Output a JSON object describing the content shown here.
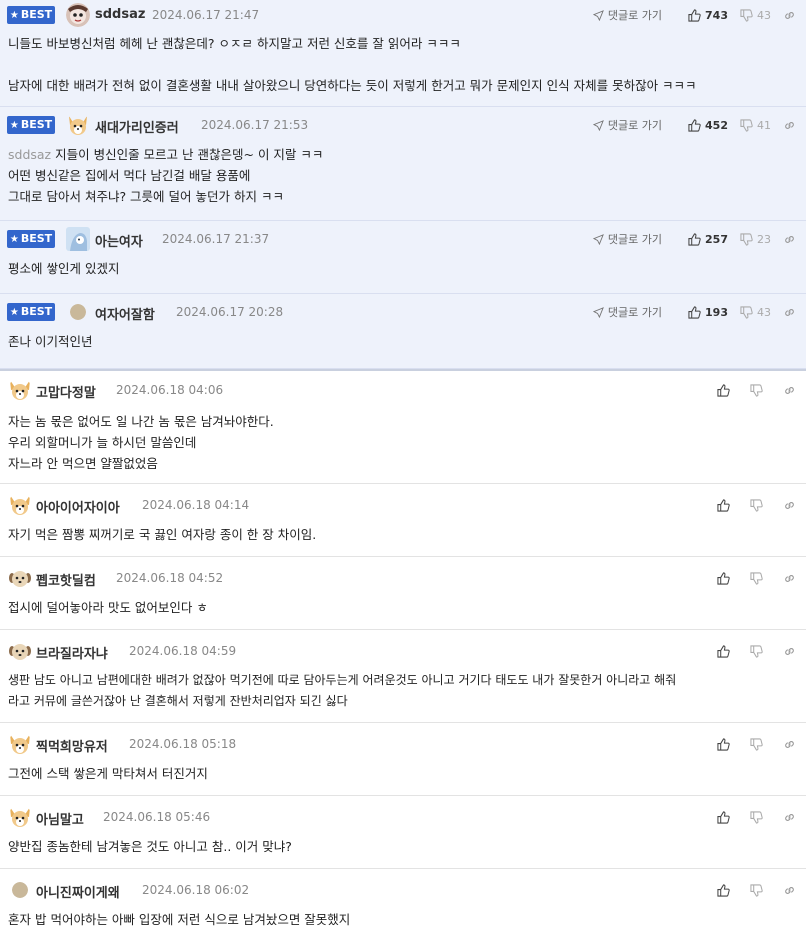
{
  "best_label": "BEST",
  "reply_label": "댓글로 가기",
  "best_comments": [
    {
      "nick": "sddsaz",
      "date": "2024.06.17 21:47",
      "up": "743",
      "down": "43",
      "lines": [
        "니들도 바보병신처럼 헤헤 난 괜찮은데? ㅇㅈㄹ 하지말고 저런 신호를 잘 읽어라 ㅋㅋㅋ",
        "",
        "남자에 대한 배려가 전혀 없이 결혼생활 내내 살아왔으니 당연하다는 듯이 저렇게 한거고 뭐가 문제인지 인식 자체를 못하잖아 ㅋㅋㅋ"
      ]
    },
    {
      "nick": "새대가리인증러",
      "date": "2024.06.17 21:53",
      "up": "452",
      "down": "41",
      "mention": "sddsaz",
      "lines": [
        " 지들이 병신인줄 모르고 난 괜찮은뎅~ 이 지랄 ㅋㅋ",
        "어떤 병신같은 집에서 먹다 남긴걸 배달 용품에",
        "그대로 담아서 쳐주냐? 그릇에 덜어 놓던가 하지 ㅋㅋ"
      ]
    },
    {
      "nick": "아는여자",
      "date": "2024.06.17 21:37",
      "up": "257",
      "down": "23",
      "lines": [
        "평소에 쌓인게 있겠지"
      ]
    },
    {
      "nick": "여자어잘함",
      "date": "2024.06.17 20:28",
      "up": "193",
      "down": "43",
      "lines": [
        "존나 이기적인년"
      ]
    }
  ],
  "comments": [
    {
      "nick": "고맙다정말",
      "date": "2024.06.18 04:06",
      "lines": [
        "자는 놈 몫은 없어도 일 나간 놈 몫은 남겨놔야한다.",
        "우리 외할머니가 늘 하시던 말씀인데",
        "자느라 안 먹으면 얄짤없었음"
      ]
    },
    {
      "nick": "아아이어자이아",
      "date": "2024.06.18 04:14",
      "lines": [
        "자기 먹은 짬뽕 찌꺼기로 국 끓인 여자랑 종이 한 장 차이임."
      ]
    },
    {
      "nick": "펩코핫딜컴",
      "date": "2024.06.18 04:52",
      "lines": [
        "접시에 덜어놓아라 맛도 없어보인다 ㅎ"
      ]
    },
    {
      "nick": "브라질라자냐",
      "date": "2024.06.18 04:59",
      "lines": [
        "생판 남도 아니고 남편에대한 배려가 없잖아 먹기전에 따로 담아두는게 어려운것도 아니고 거기다 태도도 내가 잘못한거 아니라고 해줘",
        "라고 커뮤에 글쓴거잖아 난 결혼해서 저렇게 잔반처리업자 되긴 싫다"
      ]
    },
    {
      "nick": "찍먹희망유저",
      "date": "2024.06.18 05:18",
      "lines": [
        "그전에 스택 쌓은게 막타쳐서 터진거지"
      ]
    },
    {
      "nick": "아님말고",
      "date": "2024.06.18 05:46",
      "lines": [
        "양반집 종놈한테 남겨놓은 것도 아니고 참.. 이거 맞냐?"
      ]
    },
    {
      "nick": "아니진짜이게왜",
      "date": "2024.06.18 06:02",
      "lines": [
        "혼자 밥 먹어야하는 아빠 입장에 저런 식으로 남겨놨으면 잘못했지"
      ]
    }
  ]
}
